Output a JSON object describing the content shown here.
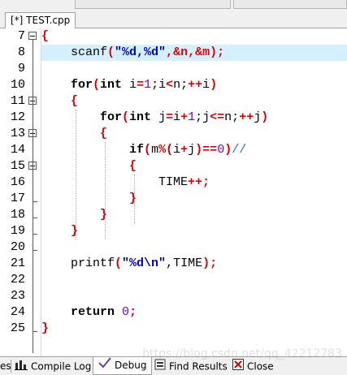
{
  "file_tab": {
    "label": "[*] TEST.cpp"
  },
  "lines": [
    {
      "n": "7",
      "fold": "open"
    },
    {
      "n": "8"
    },
    {
      "n": "9"
    },
    {
      "n": "10"
    },
    {
      "n": "11",
      "fold": "open"
    },
    {
      "n": "12"
    },
    {
      "n": "13",
      "fold": "open"
    },
    {
      "n": "14"
    },
    {
      "n": "15",
      "fold": "open"
    },
    {
      "n": "16"
    },
    {
      "n": "17"
    },
    {
      "n": "18"
    },
    {
      "n": "19"
    },
    {
      "n": "20"
    },
    {
      "n": "21"
    },
    {
      "n": "22"
    },
    {
      "n": "23"
    },
    {
      "n": "24"
    },
    {
      "n": "25"
    }
  ],
  "code": {
    "l7": {
      "brace": "{"
    },
    "l8": {
      "fn": "scanf",
      "open": "(",
      "str": "\"%d,%d\"",
      "rest": ",&n,&m",
      "close": ");"
    },
    "l10": {
      "kw": "for",
      "p1": "(",
      "kw2": "int",
      "a": " i",
      "eq": "=",
      "one": "1",
      "b": ";i",
      "lt": "<",
      "c": "n;",
      "inc": "++",
      "d": "i",
      "p2": ")"
    },
    "l11": {
      "brace": "{"
    },
    "l12": {
      "kw": "for",
      "p1": "(",
      "kw2": "int",
      "a": " j",
      "eq": "=",
      "b": "i",
      "plus": "+",
      "one": "1",
      "c": ";j",
      "le": "<=",
      "d": "n;",
      "inc": "++",
      "e": "j",
      "p2": ")"
    },
    "l13": {
      "brace": "{"
    },
    "l14": {
      "kw": "if",
      "p1": "(",
      "a": "m",
      "mod": "%",
      "p3": "(",
      "b": "i",
      "plus": "+",
      "c": "j",
      "p4": ")",
      "eqeq": "==",
      "zero": "0",
      "p2": ")",
      "cmt": "//"
    },
    "l15": {
      "brace": "{"
    },
    "l16": {
      "a": "TIME",
      "inc": "++;"
    },
    "l17": {
      "brace": "}"
    },
    "l18": {
      "brace": "}"
    },
    "l19": {
      "brace": "}"
    },
    "l21": {
      "fn": "printf",
      "open": "(",
      "str": "\"%d\\n\"",
      "rest": ",TIME",
      "close": ");"
    },
    "l24": {
      "kw": "return",
      "zero": "0",
      "semi": ";"
    },
    "l25": {
      "brace": "}"
    }
  },
  "bottom_tabs": {
    "partial": "es",
    "compile_log": "Compile Log",
    "debug": "Debug",
    "find_results": "Find Results",
    "close": "Close"
  },
  "watermark": "https://blog.csdn.net/qq_42212783"
}
